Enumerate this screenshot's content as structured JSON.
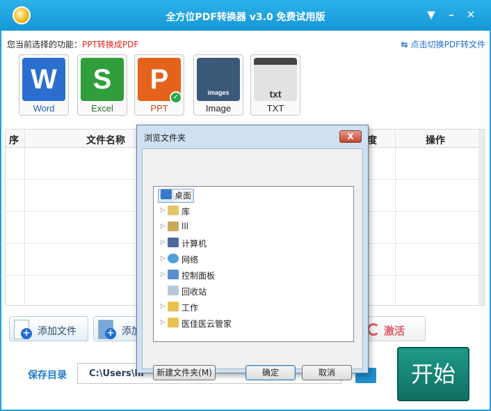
{
  "app": {
    "title": "全方位PDF转换器 v3.0 免费试用版"
  },
  "window": {
    "menu_icon": "dropdown-icon",
    "minimize": "–",
    "close": "✕"
  },
  "function_bar": {
    "label": "您当前选择的功能：",
    "value": "PPT转换成PDF",
    "switch_link": "点击切换PDF转文件",
    "switch_icon": "swap-arrows-icon"
  },
  "formats": [
    {
      "label": "Word",
      "glyph": "W",
      "color": "#2a6fcf"
    },
    {
      "label": "Excel",
      "glyph": "S",
      "color": "#2f9e3b"
    },
    {
      "label": "PPT",
      "glyph": "P",
      "color": "#e4621b"
    },
    {
      "label": "Image",
      "glyph": "images",
      "color": "#3a5878"
    },
    {
      "label": "TXT",
      "glyph": "txt",
      "color": "#d8d8d8"
    }
  ],
  "table": {
    "columns": [
      "序",
      "文件名称",
      "度",
      "操作"
    ]
  },
  "actions": {
    "add_file": "添加文件",
    "add_folder_partial": "添加",
    "activate": "激活"
  },
  "save": {
    "label": "保存目录",
    "path": "C:\\Users\\lll"
  },
  "start_button": "开始",
  "dialog": {
    "title": "浏览文件夹",
    "close": "X",
    "tree": [
      "桌面",
      "库",
      "lll",
      "计算机",
      "网络",
      "控制面板",
      "回收站",
      "工作",
      "医佳医云管家"
    ],
    "new_folder_button": "新建文件夹(M)",
    "ok_button": "确定",
    "cancel_button": "取消"
  }
}
